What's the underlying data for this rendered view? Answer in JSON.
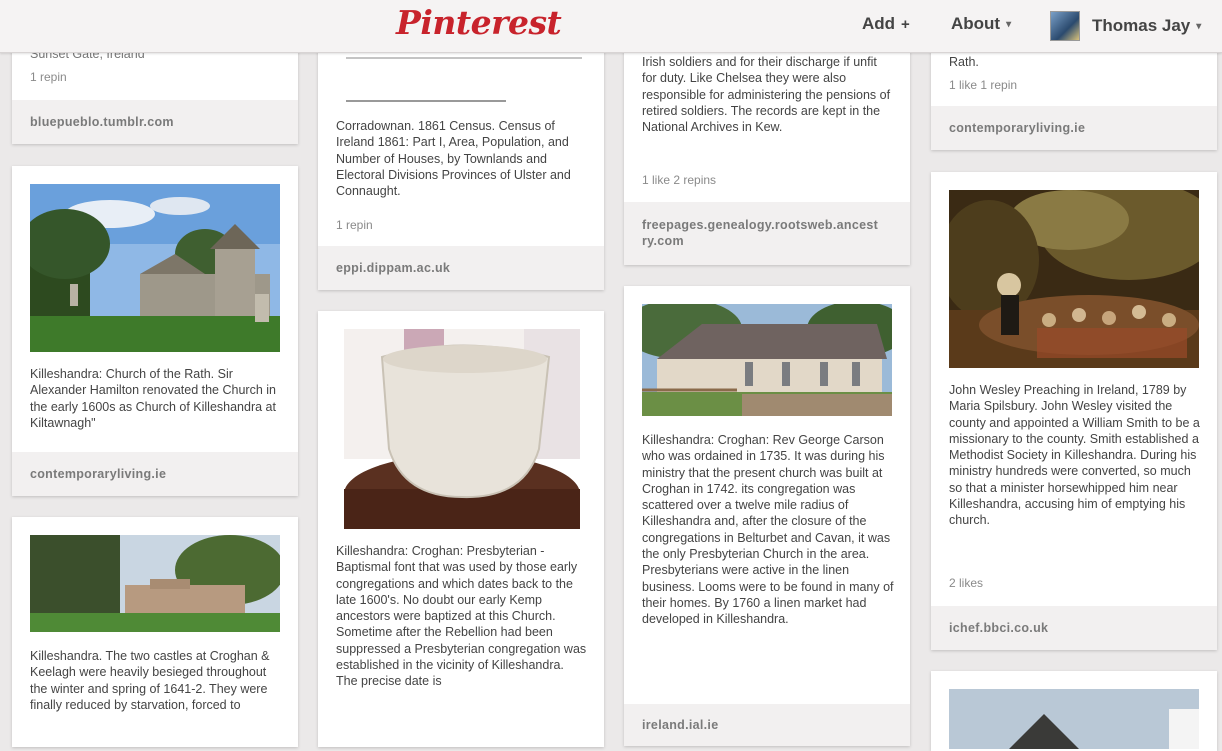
{
  "header": {
    "logo": "Pinterest",
    "add_label": "Add",
    "add_icon": "+",
    "about_label": "About",
    "caret": "▾",
    "user_name": "Thomas Jay"
  },
  "pins": {
    "c1p1": {
      "desc": "Sunset Gate, Ireland",
      "meta": "1 repin",
      "src": "bluepueblo.tumblr.com"
    },
    "c1p2": {
      "desc": "Killeshandra: Church of the Rath. Sir Alexander Hamilton renovated the Church in the early 1600s as Church of Killeshandra at Kiltawnagh\"",
      "src": "contemporaryliving.ie"
    },
    "c1p3": {
      "desc": "Killeshandra. The two castles at Croghan & Keelagh were heavily besieged throughout the winter and spring of 1641-2. They were finally reduced by starvation, forced to"
    },
    "c2p1": {
      "desc": "Corradownan. 1861 Census. Census of Ireland 1861: Part I, Area, Population, and Number of Houses, by Townlands and Electoral Divisions Provinces of Ulster and Connaught.",
      "meta": "1 repin",
      "src": "eppi.dippam.ac.uk"
    },
    "c2p2": {
      "desc": "Killeshandra: Croghan: Presbyterian - Baptismal font that was used by those early congregations and which dates back to the late 1600's. No doubt our early Kemp ancestors were baptized at this Church. Sometime after the Rebellion had been suppressed a Presbyterian congregation was established in the vicinity of Killeshandra. The precise date is"
    },
    "c3p1": {
      "desc": "Irish soldiers and for their discharge if unfit for duty. Like Chelsea they were also responsible for administering the pensions of retired soldiers. The records are kept in the National Archives in Kew.",
      "meta": "1 like   2 repins",
      "src": "freepages.genealogy.rootsweb.ancestry.com"
    },
    "c3p2": {
      "desc": "Killeshandra: Croghan: Rev George Carson who was ordained in 1735. It was during his ministry that the present church was built at Croghan in 1742. its congregation was scattered over a twelve mile radius of Killeshandra and, after the closure of the congregations in Belturbet and Cavan, it was the only Presbyterian Church in the area. Presbyterians were active in the linen business. Looms were to be found in many of their homes. By 1760 a linen market had developed in Killeshandra.",
      "src": "ireland.ial.ie"
    },
    "c4p1": {
      "desc": "Rath.",
      "meta": "1 like   1 repin",
      "src": "contemporaryliving.ie"
    },
    "c4p2": {
      "desc": "John Wesley Preaching in Ireland, 1789 by Maria Spilsbury. John Wesley visited the county and appointed a William Smith to be a missionary to the county. Smith established a Methodist Society in Killeshandra. During his ministry hundreds were converted, so much so that a minister horsewhipped him near Killeshandra, accusing him of emptying his church.",
      "meta": "2 likes",
      "src": "ichef.bbci.co.uk"
    }
  },
  "colors": {
    "brand": "#c8232c",
    "background": "#ebe9e9"
  }
}
